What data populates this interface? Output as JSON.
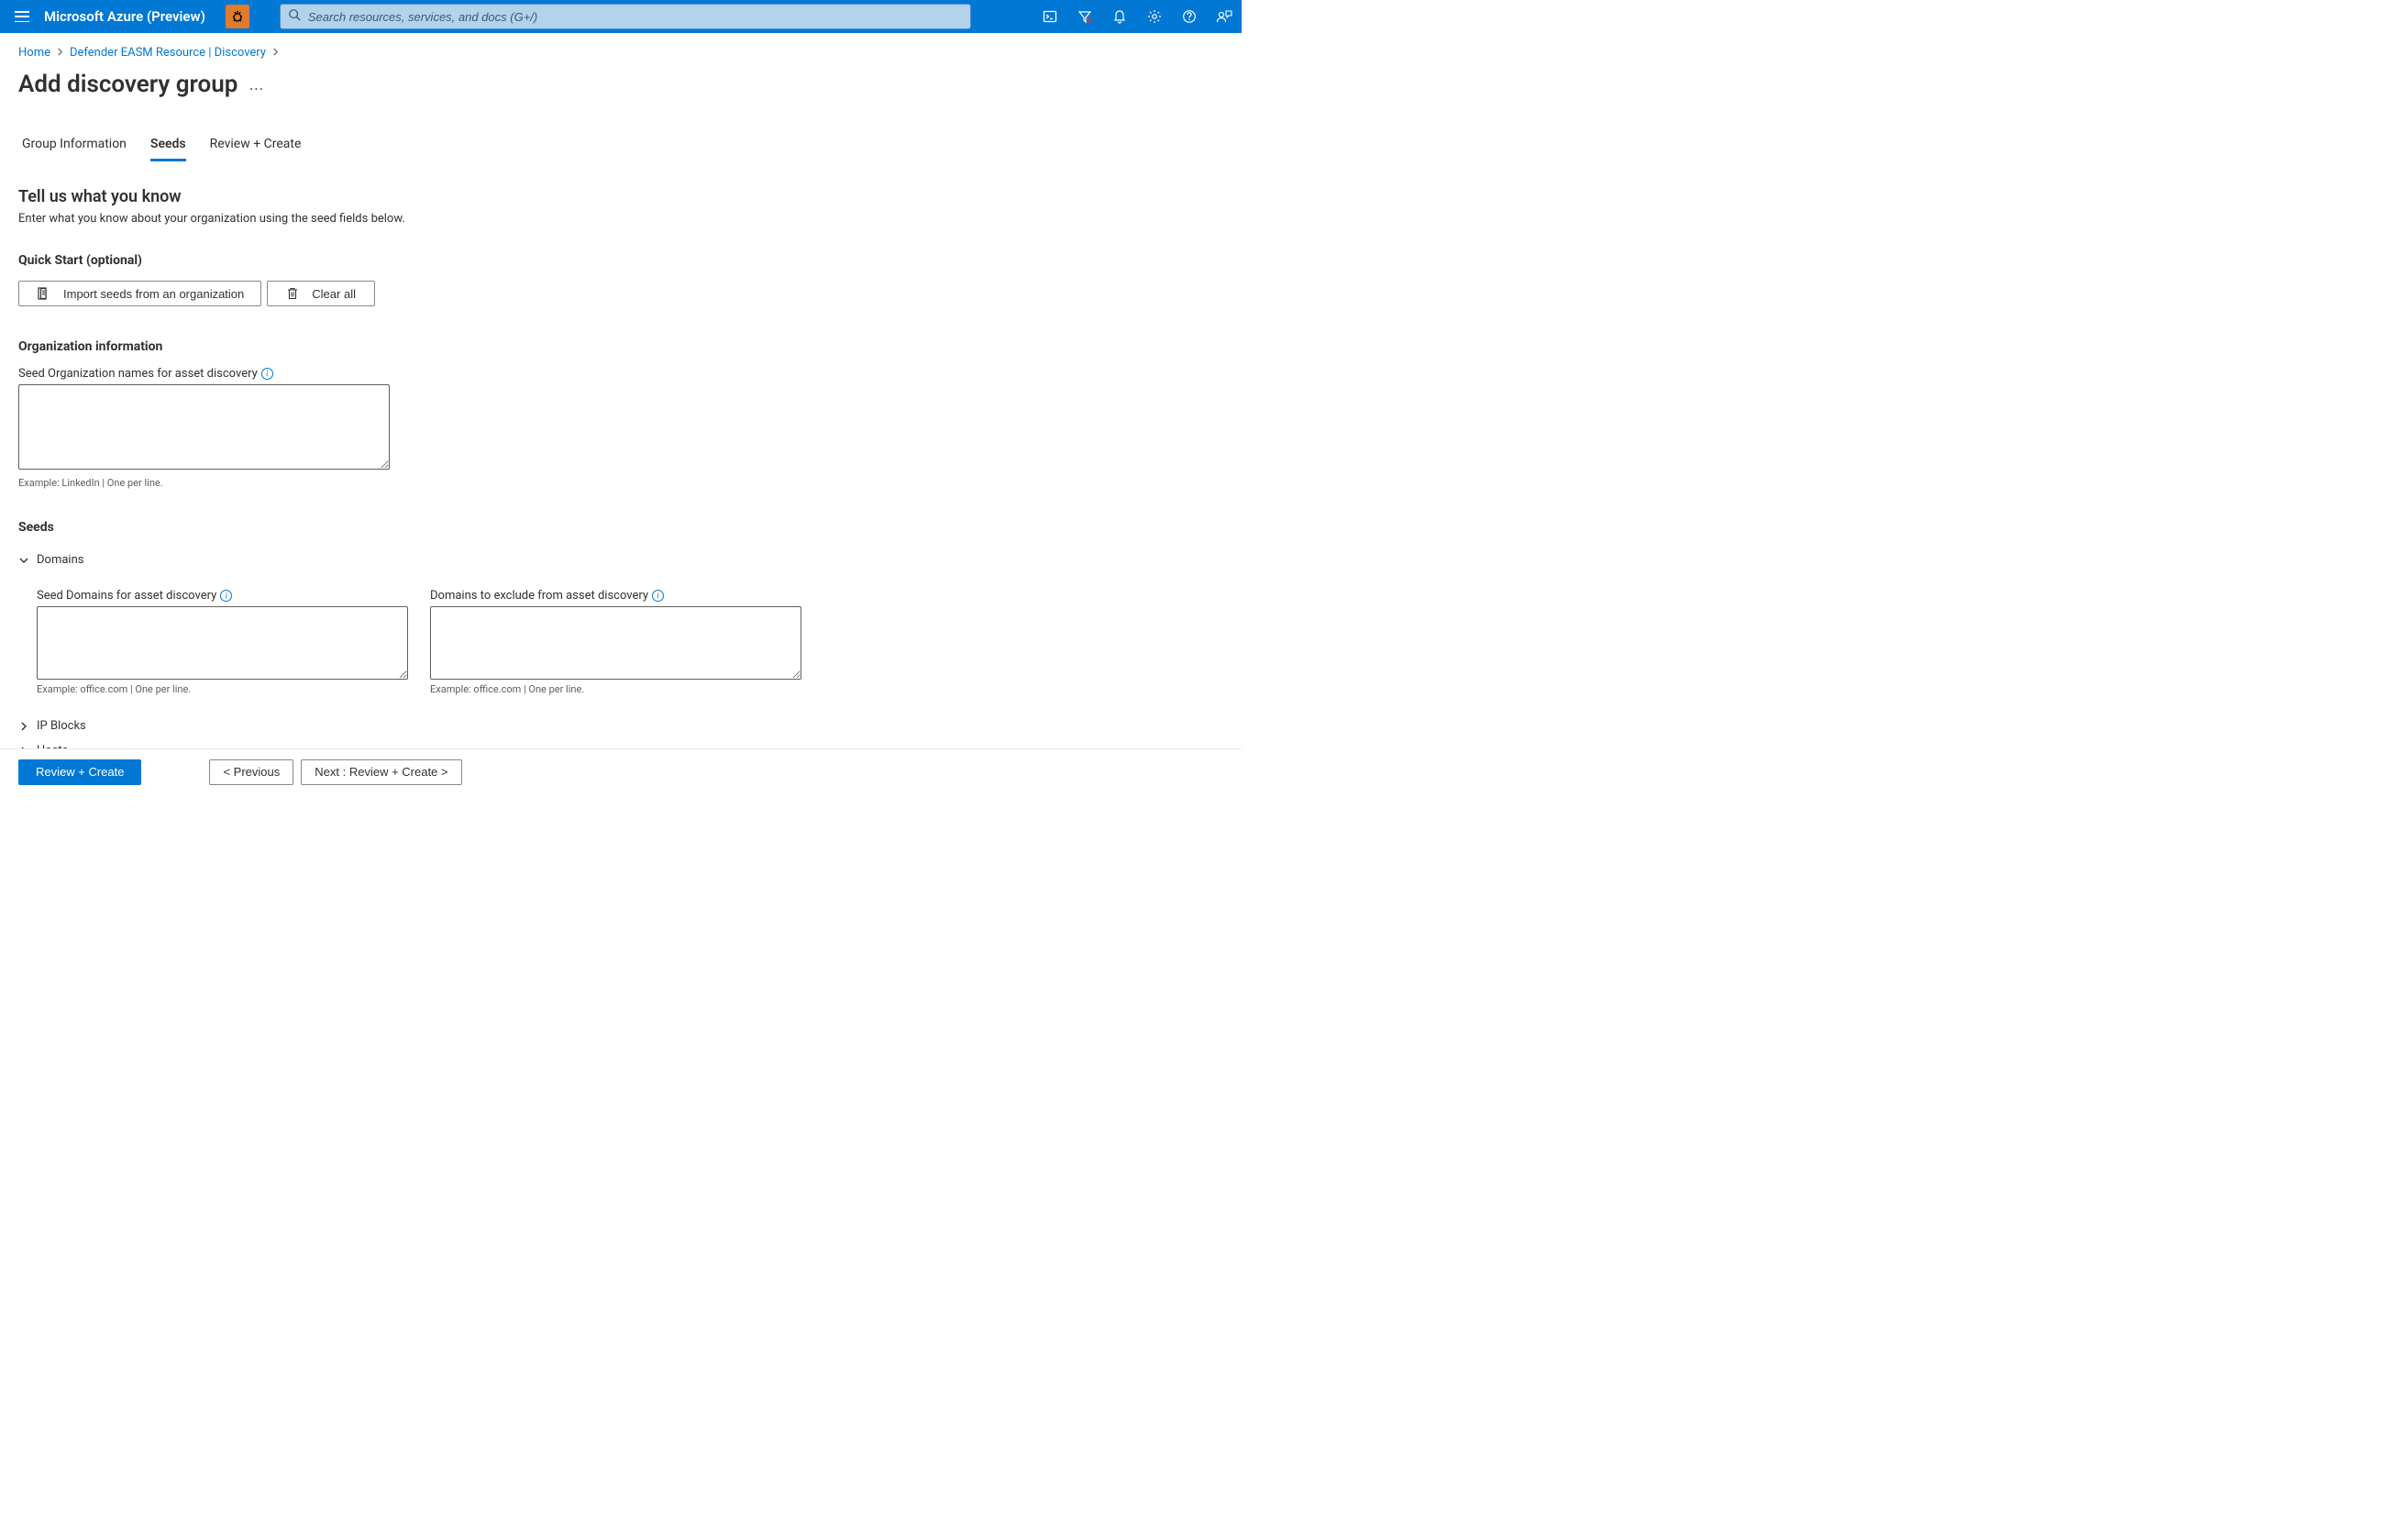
{
  "topbar": {
    "brand": "Microsoft Azure (Preview)",
    "search_placeholder": "Search resources, services, and docs (G+/)"
  },
  "breadcrumb": {
    "items": [
      "Home",
      "Defender EASM Resource | Discovery"
    ]
  },
  "page": {
    "title": "Add discovery group"
  },
  "tabs": {
    "items": [
      {
        "label": "Group Information",
        "active": false
      },
      {
        "label": "Seeds",
        "active": true
      },
      {
        "label": "Review + Create",
        "active": false
      }
    ]
  },
  "intro": {
    "heading": "Tell us what you know",
    "sub": "Enter what you know about your organization using the seed fields below."
  },
  "quick_start": {
    "heading": "Quick Start (optional)",
    "import_label": "Import seeds from an organization",
    "clear_label": "Clear all"
  },
  "org_info": {
    "heading": "Organization information",
    "label": "Seed Organization names for asset discovery",
    "hint": "Example: LinkedIn | One per line."
  },
  "seeds": {
    "heading": "Seeds",
    "domains": {
      "label": "Domains",
      "seed_label": "Seed Domains for asset discovery",
      "seed_hint": "Example: office.com | One per line.",
      "exclude_label": "Domains to exclude from asset discovery",
      "exclude_hint": "Example: office.com | One per line."
    },
    "ip_blocks": {
      "label": "IP Blocks"
    },
    "hosts": {
      "label": "Hosts"
    }
  },
  "footer": {
    "review_create": "Review + Create",
    "previous": "< Previous",
    "next": "Next : Review + Create >"
  }
}
